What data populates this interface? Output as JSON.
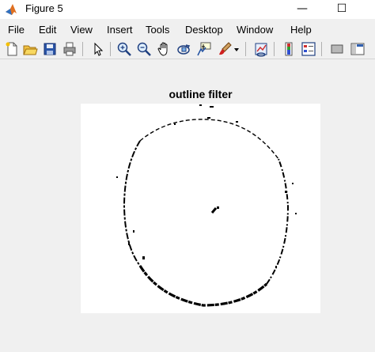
{
  "window": {
    "title": "Figure 5",
    "minimize_glyph": "—",
    "maximize_glyph": "☐"
  },
  "menu": {
    "items": [
      "File",
      "Edit",
      "View",
      "Insert",
      "Tools",
      "Desktop",
      "Window",
      "Help"
    ]
  },
  "toolbar": {
    "icons": [
      "new-figure-icon",
      "open-file-icon",
      "save-icon",
      "print-icon",
      "pointer-icon",
      "zoom-in-icon",
      "zoom-out-icon",
      "pan-hand-icon",
      "rotate-3d-icon",
      "data-cursor-icon",
      "brush-icon",
      "brush-dropdown-icon",
      "link-plot-icon",
      "insert-colorbar-icon",
      "insert-legend-icon",
      "hide-plot-tools-icon",
      "show-plot-tools-icon"
    ]
  },
  "axes": {
    "title": "outline filter"
  },
  "colors": {
    "window_bg": "#f0f0f0",
    "titlebar_bg": "#ffffff",
    "image_bg": "#ffffff",
    "outline": "#000000"
  }
}
